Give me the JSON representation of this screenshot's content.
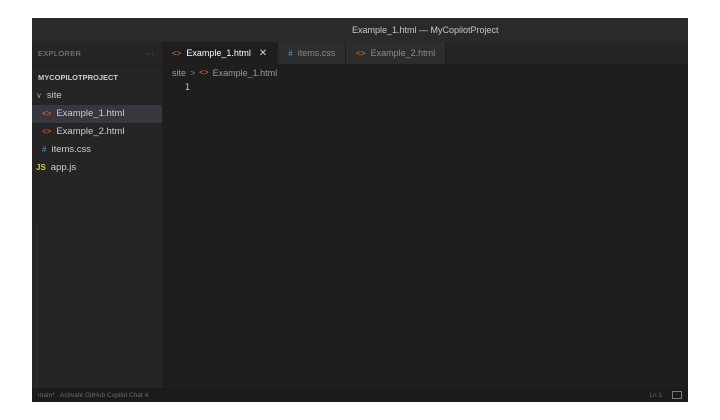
{
  "window": {
    "title": "Example_1.html — MyCopilotProject"
  },
  "explorer": {
    "header": "EXPLORER",
    "more": "···",
    "project": "MYCOPILOTPROJECT",
    "folder": "site",
    "folder_chevron": "∨",
    "items": [
      {
        "label": "Example_1.html",
        "icon": "html-file-icon",
        "glyph": "<>"
      },
      {
        "label": "Example_2.html",
        "icon": "html-file-icon",
        "glyph": "<>"
      },
      {
        "label": "items.css",
        "icon": "css-file-icon",
        "glyph": "#"
      }
    ],
    "root_file": {
      "label": "app.js",
      "icon": "js-file-icon",
      "glyph": "JS"
    }
  },
  "tabs": [
    {
      "label": "Example_1.html",
      "glyph": "<>",
      "active": true,
      "close": "✕"
    },
    {
      "label": "items.css",
      "glyph": "#",
      "active": false
    },
    {
      "label": "Example_2.html",
      "glyph": "<>",
      "active": false
    }
  ],
  "breadcrumb": {
    "folder": "site",
    "sep": ">",
    "glyph": "<>",
    "file": "Example_1.html"
  },
  "editor": {
    "line_number": "1"
  },
  "statusbar": {
    "left": "main* · Activate GitHub Copilot Chat  4",
    "right": "Ln 1"
  },
  "colors": {
    "editor_bg": "#1e1e1e",
    "sidebar_bg": "#252526",
    "html_icon": "#e37933",
    "css_icon": "#519aba",
    "js_icon": "#cbcb41"
  }
}
